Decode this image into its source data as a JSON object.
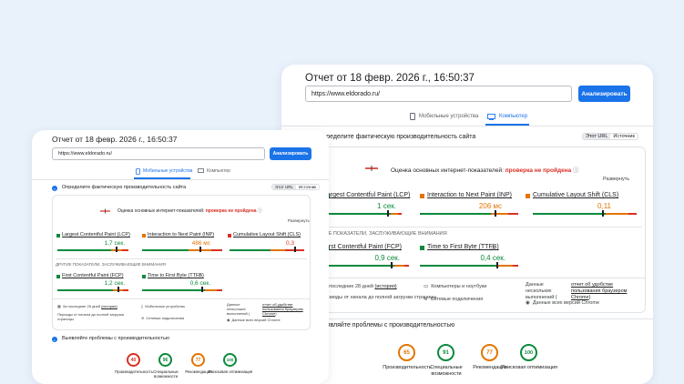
{
  "report": {
    "title": "Отчет от 18 февр. 2026 г., 16:50:37",
    "url_value": "https://www.eldorado.ru/",
    "analyze_label": "Анализировать",
    "tab_mobile": "Мобильные устройства",
    "tab_desktop": "Компьютер"
  },
  "section1": {
    "title": "Определите фактическую производительность сайта",
    "toggle_this_url": "Этот URL",
    "toggle_origin": "Источник",
    "cwv_prefix": "Оценка основных интернет-показателей:",
    "cwv_status": " проверка не пройдена",
    "expand": "Развернуть",
    "other_label": "ДРУГИЕ ПОКАЗАТЕЛИ, ЗАСЛУЖИВАЮЩИЕ ВНИМАНИЯ"
  },
  "metrics_common": {
    "lcp": "Largest Contentful Paint (LCP)",
    "inp": "Interaction to Next Paint (INP)",
    "cls": "Cumulative Layout Shift (CLS)",
    "fcp": "First Contentful Paint (FCP)",
    "ttfb": "Time to First Byte (TTFB)"
  },
  "desktop_values": {
    "lcp": "1 сек.",
    "inp": "206 мс",
    "cls": "0,11",
    "fcp": "0,9 сек.",
    "ttfb": "0,4 сек."
  },
  "mobile_values": {
    "lcp": "1,7 сек.",
    "inp": "486 мс",
    "cls": "0,3",
    "fcp": "1,2 сек.",
    "ttfb": "0,6 сек."
  },
  "footer": {
    "period": "За последние 28 дней",
    "period_link": "(история)",
    "visits": "Периоды от начала до полной загрузки страницы",
    "devices_desktop": "Компьютеры и ноутбуки",
    "devices_mobile": "Мобильные устройства",
    "network": "Сетевые подключения",
    "data_label": "Данные нескольких выполнений (",
    "data_link": "отчет об удобстве пользования браузером Chrome",
    "data_suffix": ")",
    "versions": "Данные всех версий Chrome"
  },
  "section2": {
    "title": "Выявляйте проблемы с производительностью"
  },
  "scores_desktop": [
    {
      "value": "65",
      "label": "Производительность",
      "color": "#e37400"
    },
    {
      "value": "91",
      "label": "Специальные возможности",
      "color": "#0c8a3c"
    },
    {
      "value": "77",
      "label": "Рекомендации",
      "color": "#e37400"
    },
    {
      "value": "100",
      "label": "Поисковая оптимизация",
      "color": "#0c8a3c"
    }
  ],
  "scores_mobile": [
    {
      "value": "40",
      "label": "Производительность",
      "color": "#d93025"
    },
    {
      "value": "96",
      "label": "Специальные возможности",
      "color": "#0c8a3c"
    },
    {
      "value": "77",
      "label": "Рекомендации",
      "color": "#e37400"
    },
    {
      "value": "100",
      "label": "Поисковая оптимизация",
      "color": "#0c8a3c"
    }
  ],
  "colors": {
    "good": "#0c8a3c",
    "average": "#e37400",
    "poor": "#d93025",
    "accent": "#1a73e8"
  }
}
